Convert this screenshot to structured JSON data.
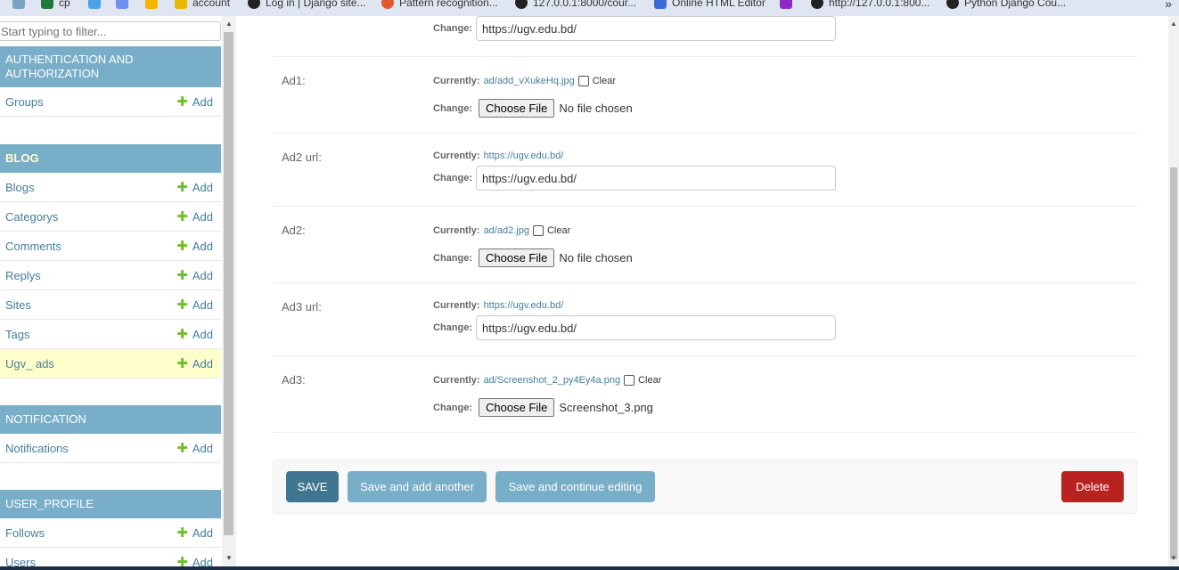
{
  "bookmarks": {
    "items": [
      {
        "label": "",
        "color": "#7aa3c2"
      },
      {
        "label": "cp",
        "color": "#1f7a3a"
      },
      {
        "label": "",
        "color": "#4aa3e8"
      },
      {
        "label": "",
        "color": "#6d8ff0"
      },
      {
        "label": "",
        "color": "#f5b400"
      },
      {
        "label": "account",
        "color": "#e6b800"
      },
      {
        "label": "Log in | Django site...",
        "color": "#222222"
      },
      {
        "label": "Pattern recognition...",
        "color": "#e05a2b"
      },
      {
        "label": "127.0.0.1:8000/cour...",
        "color": "#222222"
      },
      {
        "label": "Online HTML Editor",
        "color": "#3c6bd6"
      },
      {
        "label": "",
        "color": "#8c2bc8"
      },
      {
        "label": "http://127.0.0.1:800...",
        "color": "#222222"
      },
      {
        "label": "Python Django Cou...",
        "color": "#222222"
      }
    ],
    "more": "»"
  },
  "sidebar": {
    "filter_placeholder": "Start typing to filter...",
    "add_label": "Add",
    "apps": [
      {
        "name": "AUTHENTICATION AND AUTHORIZATION",
        "models": [
          {
            "name": "Groups"
          }
        ]
      },
      {
        "name": "BLOG",
        "models": [
          {
            "name": "Blogs"
          },
          {
            "name": "Categorys"
          },
          {
            "name": "Comments"
          },
          {
            "name": "Replys"
          },
          {
            "name": "Sites"
          },
          {
            "name": "Tags"
          },
          {
            "name": "Ugv_ ads",
            "active": true
          }
        ]
      },
      {
        "name": "NOTIFICATION",
        "models": [
          {
            "name": "Notifications"
          }
        ]
      },
      {
        "name": "USER_PROFILE",
        "models": [
          {
            "name": "Follows"
          },
          {
            "name": "Users"
          }
        ]
      }
    ]
  },
  "form": {
    "currently_label": "Currently:",
    "change_label": "Change:",
    "clear_label": "Clear",
    "choose_file_label": "Choose File",
    "top_url_value": "https://ugv.edu.bd/",
    "rows": [
      {
        "label": "Ad1:",
        "type": "file",
        "current": "ad/add_vXukeHq.jpg",
        "file_status": "No file chosen"
      },
      {
        "label": "Ad2 url:",
        "type": "url",
        "current": "https://ugv.edu.bd/",
        "value": "https://ugv.edu.bd/"
      },
      {
        "label": "Ad2:",
        "type": "file",
        "current": "ad/ad2.jpg",
        "file_status": "No file chosen"
      },
      {
        "label": "Ad3 url:",
        "type": "url",
        "current": "https://ugv.edu.bd/",
        "value": "https://ugv.edu.bd/"
      },
      {
        "label": "Ad3:",
        "type": "file",
        "current": "ad/Screenshot_2_py4Ey4a.png",
        "file_status": "Screenshot_3.png"
      }
    ]
  },
  "buttons": {
    "save": "SAVE",
    "save_add_another": "Save and add another",
    "save_continue": "Save and continue editing",
    "delete": "Delete"
  }
}
